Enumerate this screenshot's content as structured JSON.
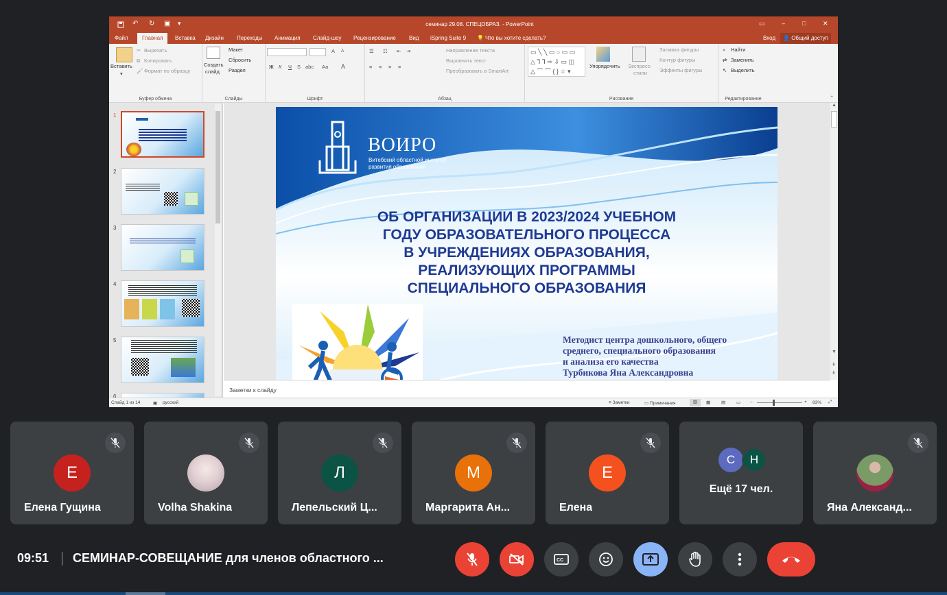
{
  "ppt": {
    "title": "семинар 29.08. СПЕЦОБРАЗ. - PowerPoint",
    "menu": [
      "Файл",
      "Главная",
      "Вставка",
      "Дизайн",
      "Переходы",
      "Анимация",
      "Слайд-шоу",
      "Рецензирование",
      "Вид",
      "iSpring Suite 9"
    ],
    "tellme": "Что вы хотите сделать?",
    "login": "Вход",
    "share": "Общий доступ",
    "ribbon": {
      "paste": "Вставить",
      "cut": "Вырезать",
      "copy": "Копировать",
      "format_painter": "Формат по образцу",
      "clipboard": "Буфер обмена",
      "new_slide_1": "Создать",
      "new_slide_2": "слайд",
      "layout": "Макет",
      "reset": "Сбросить",
      "section": "Раздел",
      "slides": "Слайды",
      "font": "Шрифт",
      "bold": "Ж",
      "italic": "К",
      "underline": "Ч",
      "strike": "S",
      "spacing": "abc",
      "case": "Аа",
      "font_color": "А",
      "grow": "A",
      "shrink": "A",
      "text_direction": "Направление текста",
      "align_text": "Выровнять текст",
      "smartart": "Преобразовать в SmartArt",
      "paragraph": "Абзац",
      "arrange_1": "Упорядочить",
      "quick_styles_1": "Экспресс-",
      "quick_styles_2": "стили",
      "shape_fill": "Заливка фигуры",
      "shape_outline": "Контур фигуры",
      "shape_effects": "Эффекты фигуры",
      "drawing": "Рисование",
      "find": "Найти",
      "replace": "Заменить",
      "select": "Выделить",
      "editing": "Редактирование"
    },
    "slide": {
      "logo_name": "ВОИРО",
      "logo_sub1": "Витебский областной институт",
      "logo_sub2": "развития образования",
      "title_lines": [
        "ОБ ОРГАНИЗАЦИИ В 2023/2024 УЧЕБНОМ",
        "ГОДУ ОБРАЗОВАТЕЛЬНОГО ПРОЦЕССА",
        "В УЧРЕЖДЕНИЯХ ОБРАЗОВАНИЯ,",
        "РЕАЛИЗУЮЩИХ ПРОГРАММЫ",
        "СПЕЦИАЛЬНОГО ОБРАЗОВАНИЯ"
      ],
      "author_lines": [
        "Методист центра дошкольного, общего",
        "среднего, специального образования",
        "и анализа его качества",
        "Турбикова Яна Александровна"
      ]
    },
    "thumb_numbers": [
      "1",
      "2",
      "3",
      "4",
      "5",
      "6"
    ],
    "notes_placeholder": "Заметки к слайду",
    "status": {
      "slide_of": "Слайд 1 из 14",
      "language": "русский",
      "notes": "Заметки",
      "comments": "Примечания",
      "zoom": "83%"
    }
  },
  "participants": [
    {
      "name": "Елена Гущина",
      "initial": "Е",
      "color": "#c5221f"
    },
    {
      "name": "Volha Shakina",
      "initial": "",
      "color": "#e8d8dc"
    },
    {
      "name": "Лепельский Ц...",
      "initial": "Л",
      "color": "#0b5345"
    },
    {
      "name": "Маргарита Ан...",
      "initial": "М",
      "color": "#e8710a"
    },
    {
      "name": "Елена",
      "initial": "Е",
      "color": "#f4511e"
    },
    {
      "name": "Ещё 17 чел.",
      "initial": "",
      "color": ""
    },
    {
      "name": "Яна Александ...",
      "initial": "",
      "color": "#6a8a5a"
    }
  ],
  "more_avatars": [
    {
      "initial": "С",
      "color": "#5c6bc0"
    },
    {
      "initial": "Н",
      "color": "#0b5345"
    }
  ],
  "meeting": {
    "time": "09:51",
    "title": "СЕМИНАР-СОВЕЩАНИЕ для членов областного ..."
  },
  "colors": {
    "accent": "#b7472a",
    "red": "#ea4335",
    "blue": "#8ab4f8",
    "slide_title": "#1f3a93",
    "author": "#3b3f8f"
  }
}
